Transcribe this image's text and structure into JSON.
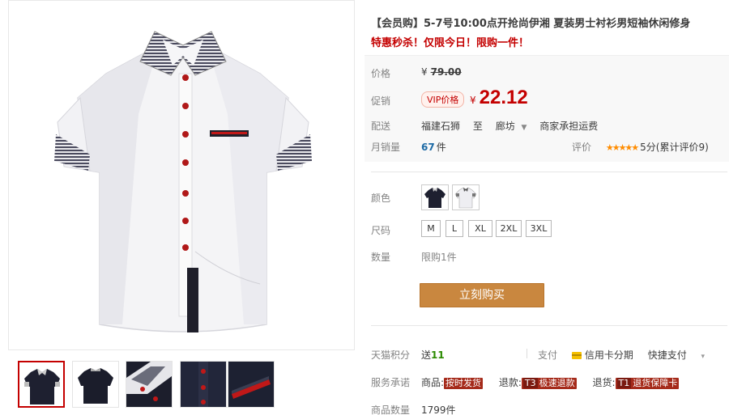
{
  "product": {
    "title": "【会员购】5-7号10:00点开抢尚伊湘 夏装男士衬衫男短袖休闲修身",
    "promo": "特惠秒杀！仅限今日！限购一件！"
  },
  "price": {
    "label": "价格",
    "currency": "¥",
    "original": "79.00"
  },
  "promotion": {
    "label": "促销",
    "vip_tag": "VIP价格",
    "currency": "¥",
    "current": "22.12"
  },
  "delivery": {
    "label": "配送",
    "from": "福建石狮",
    "to_word": "至",
    "to": "廊坊",
    "fee": "商家承担运费"
  },
  "sales": {
    "label": "月销量",
    "count": "67",
    "unit": "件"
  },
  "rating": {
    "label": "评价",
    "stars": "★★★★★",
    "score": "5分",
    "count_text": "(累计评价9)"
  },
  "color": {
    "label": "颜色",
    "options": [
      "black-shirt",
      "white-shirt"
    ]
  },
  "size": {
    "label": "尺码",
    "options": [
      "M",
      "L",
      "XL",
      "2XL",
      "3XL"
    ]
  },
  "quantity": {
    "label": "数量",
    "limit": "限购1件"
  },
  "buy_button": "立刻购买",
  "points": {
    "label": "天猫积分",
    "prefix": "送",
    "value": "11"
  },
  "payment": {
    "label": "支付",
    "credit": "信用卡分期",
    "quick": "快捷支付",
    "more": "▾"
  },
  "service": {
    "label": "服务承诺",
    "item1_prefix": "商品:",
    "item1_tag": "按时发货",
    "item2_prefix": "退款:",
    "item2_tag_pfx": "T3",
    "item2_tag": "极速退款",
    "item3_prefix": "退货:",
    "item3_tag_pfx": "T1",
    "item3_tag": "退货保障卡"
  },
  "stock": {
    "label": "商品数量",
    "value": "1799件"
  },
  "icons": {
    "card": "credit-card-icon",
    "caret": "chevron-down-icon"
  },
  "colors": {
    "accent": "#c40000",
    "buy": "#c9873f"
  }
}
